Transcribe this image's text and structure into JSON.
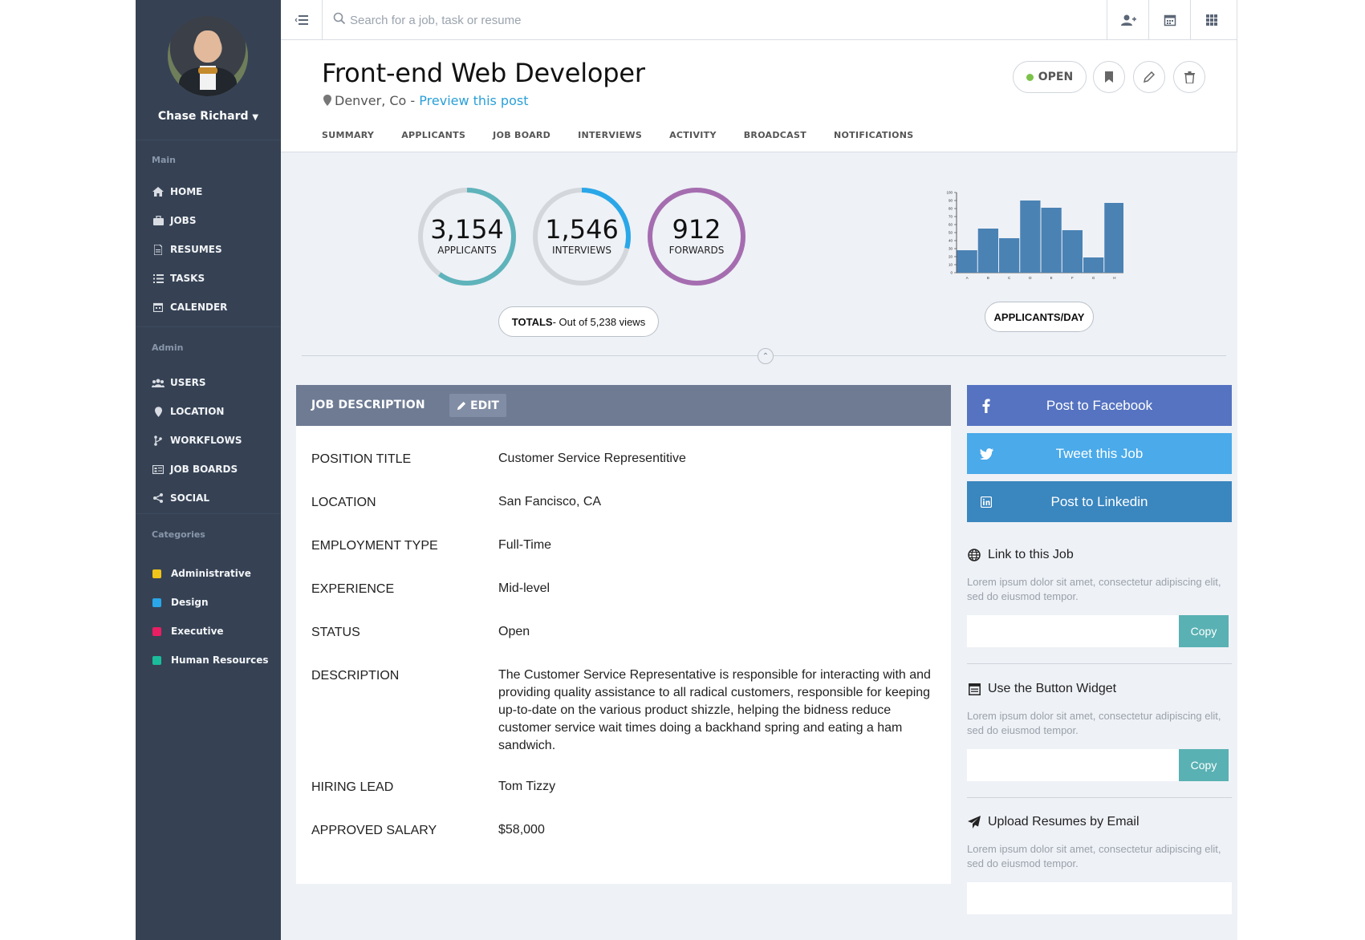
{
  "sidebar": {
    "user_name": "Chase Richard",
    "sections": {
      "main": "Main",
      "admin": "Admin",
      "categories": "Categories"
    },
    "main_items": [
      {
        "label": "HOME",
        "icon": "home-icon"
      },
      {
        "label": "JOBS",
        "icon": "briefcase-icon"
      },
      {
        "label": "RESUMES",
        "icon": "file-icon"
      },
      {
        "label": "TASKS",
        "icon": "list-icon"
      },
      {
        "label": "CALENDER",
        "icon": "calendar-icon"
      }
    ],
    "admin_items": [
      {
        "label": "USERS",
        "icon": "users-icon"
      },
      {
        "label": "LOCATION",
        "icon": "map-pin-icon"
      },
      {
        "label": "WORKFLOWS",
        "icon": "branch-icon"
      },
      {
        "label": "JOB BOARDS",
        "icon": "board-icon"
      },
      {
        "label": "SOCIAL",
        "icon": "share-icon"
      }
    ],
    "categories": [
      {
        "label": "Administrative",
        "color": "#f0c419"
      },
      {
        "label": "Design",
        "color": "#2aa7e8"
      },
      {
        "label": "Executive",
        "color": "#e91e63"
      },
      {
        "label": "Human Resources",
        "color": "#1abc9c"
      }
    ]
  },
  "search": {
    "placeholder": "Search for a job, task or resume"
  },
  "header": {
    "title": "Front-end Web Developer",
    "location": "Denver, Co - ",
    "preview_link": "Preview this post",
    "status": "OPEN",
    "status_color": "#7bc24b",
    "tabs": [
      "SUMMARY",
      "APPLICANTS",
      "JOB BOARD",
      "INTERVIEWS",
      "ACTIVITY",
      "BROADCAST",
      "NOTIFICATIONS"
    ]
  },
  "stats": {
    "gauges": [
      {
        "value": "3,154",
        "label": "APPLICANTS",
        "fraction": 0.6,
        "color": "#5fb3bb"
      },
      {
        "value": "1,546",
        "label": "INTERVIEWS",
        "fraction": 0.29,
        "color": "#2aa7e8"
      },
      {
        "value": "912",
        "label": "FORWARDS",
        "fraction": 1.0,
        "color": "#a56db0"
      }
    ],
    "totals_strong": "TOTALS",
    "totals_rest": " - Out of 5,238 views",
    "chart_label": "APPLICANTS/DAY"
  },
  "chart_data": {
    "type": "bar",
    "categories": [
      "A",
      "B",
      "C",
      "D",
      "E",
      "F",
      "G",
      "H"
    ],
    "values": [
      28,
      55,
      43,
      90,
      81,
      53,
      19,
      87
    ],
    "ylim": [
      0,
      100
    ],
    "yticks": [
      0,
      10,
      20,
      30,
      40,
      50,
      60,
      70,
      80,
      90,
      100
    ],
    "color": "#4a82b4",
    "title": "",
    "xlabel": "",
    "ylabel": ""
  },
  "job_description": {
    "title": "JOB DESCRIPTION",
    "edit_label": "EDIT",
    "rows": [
      {
        "label": "POSITION TITLE",
        "value": "Customer Service Representitive"
      },
      {
        "label": "LOCATION",
        "value": "San Fancisco, CA"
      },
      {
        "label": "EMPLOYMENT TYPE",
        "value": "Full-Time"
      },
      {
        "label": "EXPERIENCE",
        "value": "Mid-level"
      },
      {
        "label": "STATUS",
        "value": "Open"
      },
      {
        "label": "DESCRIPTION",
        "value": "The Customer Service Representative is responsible for interacting with and providing quality assistance to all radical customers, responsible for keeping up-to-date on the various product shizzle, helping the bidness reduce customer service wait times doing a backhand spring and eating a ham sandwich."
      },
      {
        "label": "HIRING LEAD",
        "value": "Tom Tizzy"
      },
      {
        "label": "APPROVED SALARY",
        "value": "$58,000"
      }
    ]
  },
  "social": [
    {
      "label": "Post to Facebook",
      "icon": "facebook-icon",
      "color": "#5573c0"
    },
    {
      "label": "Tweet this Job",
      "icon": "twitter-icon",
      "color": "#4aaaea"
    },
    {
      "label": "Post to Linkedin",
      "icon": "linkedin-icon",
      "color": "#3a86bf"
    }
  ],
  "widgets": [
    {
      "title": "Link to this Job",
      "icon": "globe-icon",
      "desc": "Lorem ipsum dolor sit amet, consectetur adipiscing elit, sed do eiusmod tempor.",
      "copy": "Copy"
    },
    {
      "title": "Use the Button Widget",
      "icon": "widget-icon",
      "desc": "Lorem ipsum dolor sit amet, consectetur adipiscing elit, sed do eiusmod tempor.",
      "copy": "Copy"
    },
    {
      "title": "Upload Resumes by Email",
      "icon": "paper-plane-icon",
      "desc": "Lorem ipsum dolor sit amet, consectetur adipiscing elit, sed do eiusmod tempor."
    }
  ]
}
